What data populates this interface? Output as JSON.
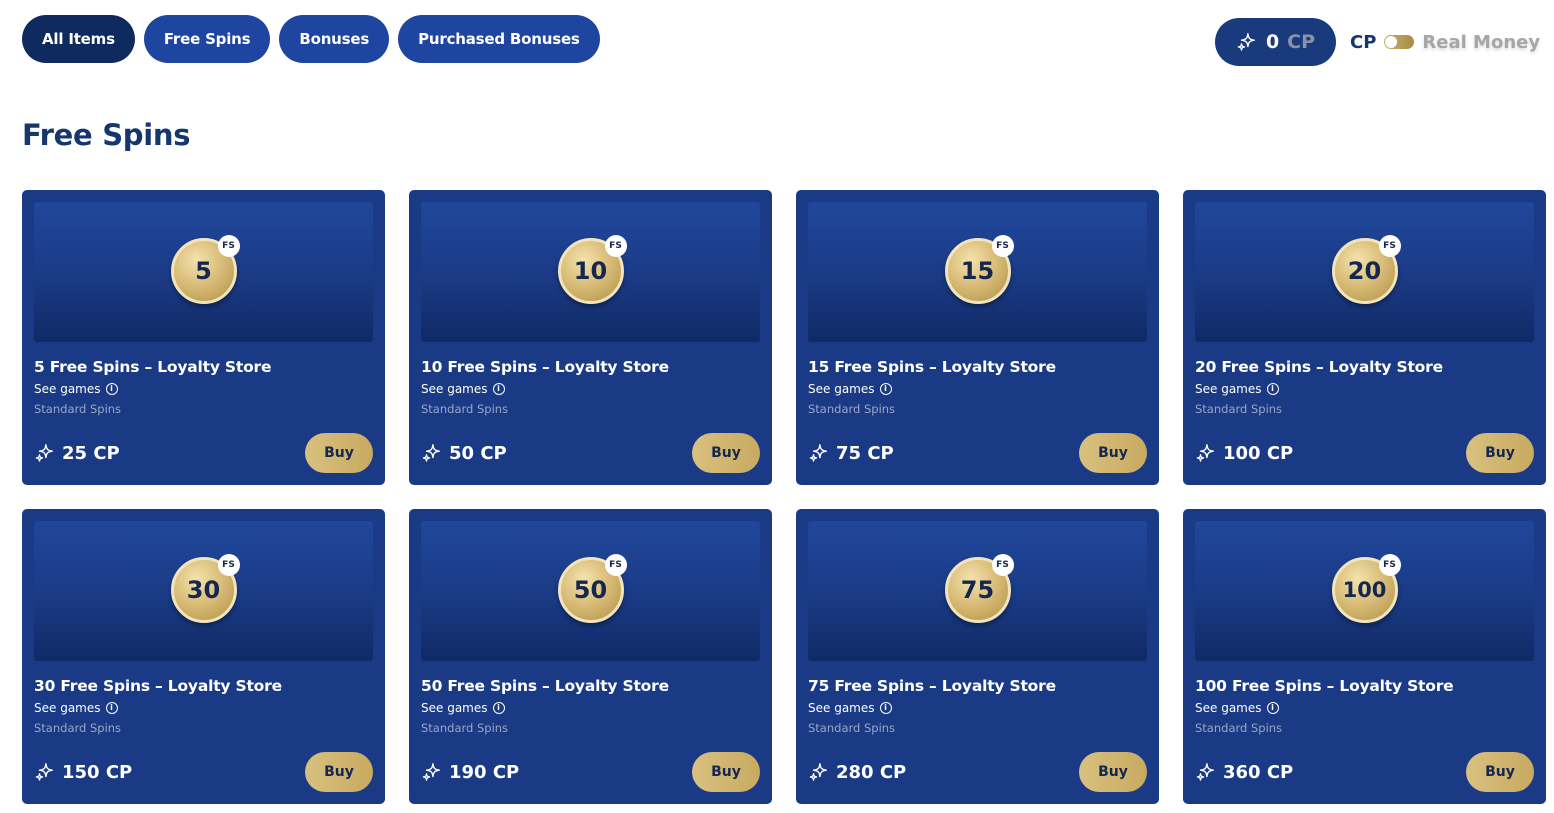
{
  "filters": [
    {
      "label": "All Items",
      "active": true
    },
    {
      "label": "Free Spins",
      "active": false
    },
    {
      "label": "Bonuses",
      "active": false
    },
    {
      "label": "Purchased Bonuses",
      "active": false
    }
  ],
  "balance": {
    "amount": "0",
    "unit": "CP",
    "icon": "sparkle-icon"
  },
  "currency_toggle": {
    "left_label": "CP",
    "right_label": "Real Money",
    "selected": "CP"
  },
  "section_title": "Free Spins",
  "cards": [
    {
      "coin": "5",
      "badge": "FS",
      "title": "5 Free Spins – Loyalty Store",
      "see_games": "See games",
      "spin_type": "Standard Spins",
      "price": "25 CP",
      "buy": "Buy"
    },
    {
      "coin": "10",
      "badge": "FS",
      "title": "10 Free Spins – Loyalty Store",
      "see_games": "See games",
      "spin_type": "Standard Spins",
      "price": "50 CP",
      "buy": "Buy"
    },
    {
      "coin": "15",
      "badge": "FS",
      "title": "15 Free Spins – Loyalty Store",
      "see_games": "See games",
      "spin_type": "Standard Spins",
      "price": "75 CP",
      "buy": "Buy"
    },
    {
      "coin": "20",
      "badge": "FS",
      "title": "20 Free Spins – Loyalty Store",
      "see_games": "See games",
      "spin_type": "Standard Spins",
      "price": "100 CP",
      "buy": "Buy"
    },
    {
      "coin": "30",
      "badge": "FS",
      "title": "30 Free Spins – Loyalty Store",
      "see_games": "See games",
      "spin_type": "Standard Spins",
      "price": "150 CP",
      "buy": "Buy"
    },
    {
      "coin": "50",
      "badge": "FS",
      "title": "50 Free Spins – Loyalty Store",
      "see_games": "See games",
      "spin_type": "Standard Spins",
      "price": "190 CP",
      "buy": "Buy"
    },
    {
      "coin": "75",
      "badge": "FS",
      "title": "75 Free Spins – Loyalty Store",
      "see_games": "See games",
      "spin_type": "Standard Spins",
      "price": "280 CP",
      "buy": "Buy"
    },
    {
      "coin": "100",
      "badge": "FS",
      "title": "100 Free Spins – Loyalty Store",
      "see_games": "See games",
      "spin_type": "Standard Spins",
      "price": "360 CP",
      "buy": "Buy"
    }
  ],
  "colors": {
    "accent_navy": "#16366e",
    "card_blue": "#1a3a86",
    "gold": "#c8aa60"
  }
}
